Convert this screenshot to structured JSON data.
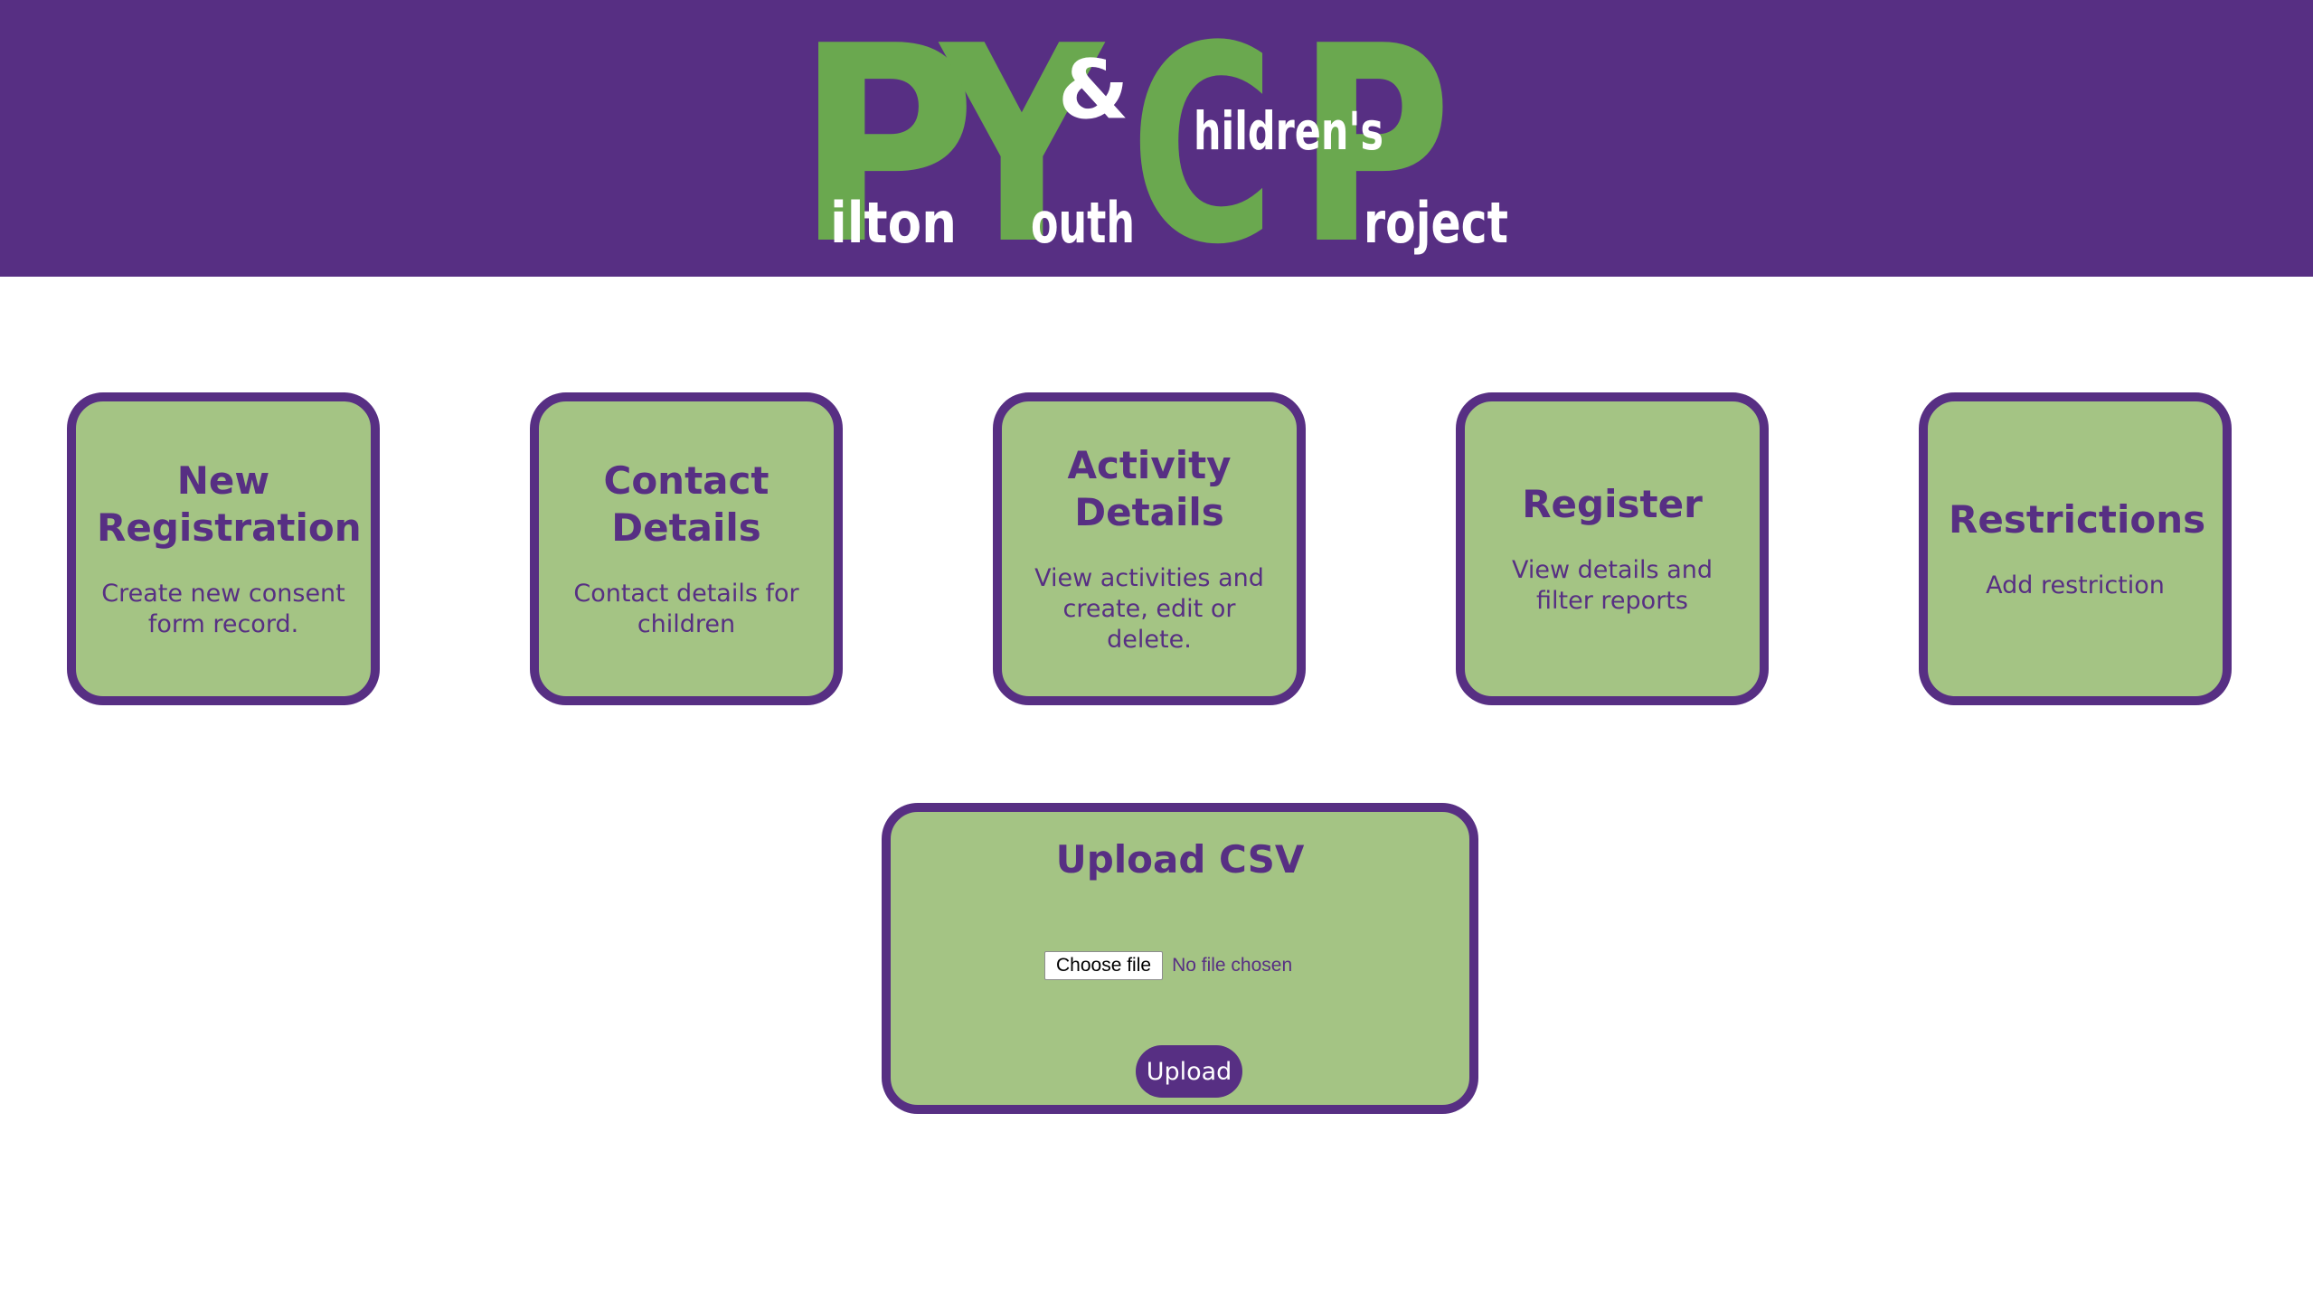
{
  "colors": {
    "brand_purple": "#572f83",
    "card_green": "#a4c484",
    "logo_green": "#6aa84f",
    "background": "#ffffff"
  },
  "header": {
    "logo": {
      "big_letters": [
        "P",
        "Y",
        "C",
        "P"
      ],
      "ampersand": "&",
      "words": [
        "ilton",
        "outh",
        "hildren's",
        "roject"
      ]
    }
  },
  "cards": [
    {
      "title": "New Registration",
      "description": "Create new consent form record."
    },
    {
      "title": "Contact Details",
      "description": "Contact details for children"
    },
    {
      "title": "Activity Details",
      "description": "View activities and create, edit or delete."
    },
    {
      "title": "Register",
      "description": "View details and filter reports"
    },
    {
      "title": "Restrictions",
      "description": "Add restriction"
    }
  ],
  "upload": {
    "title": "Upload CSV",
    "choose_file_label": "Choose file",
    "file_status": "No file chosen",
    "submit_label": "Upload"
  }
}
